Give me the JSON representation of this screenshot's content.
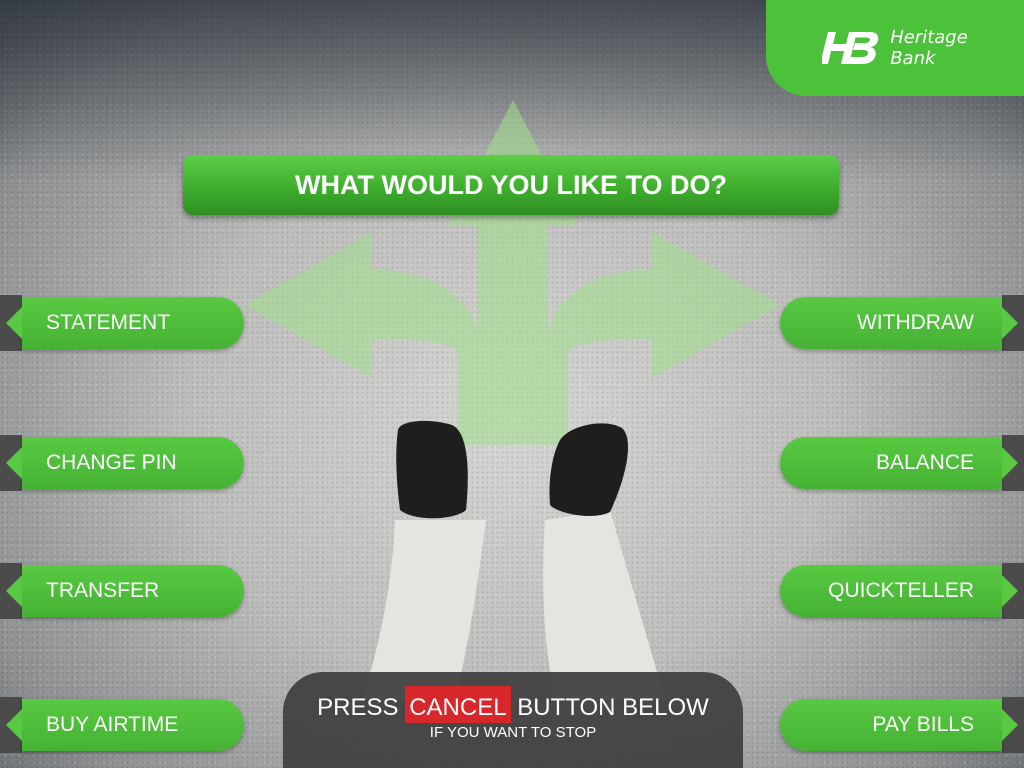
{
  "brand": {
    "logo_line1": "Heritage",
    "logo_line2": "Bank",
    "color": "#4cc13a"
  },
  "prompt": {
    "title": "WHAT WOULD YOU LIKE TO DO?"
  },
  "options": {
    "left": [
      {
        "label": "STATEMENT"
      },
      {
        "label": "CHANGE PIN"
      },
      {
        "label": "TRANSFER"
      },
      {
        "label": "BUY AIRTIME"
      }
    ],
    "right": [
      {
        "label": "WITHDRAW"
      },
      {
        "label": "BALANCE"
      },
      {
        "label": "QUICKTELLER"
      },
      {
        "label": "PAY BILLS"
      }
    ]
  },
  "cancel": {
    "before": "PRESS ",
    "highlight": "CANCEL",
    "after": " BUTTON BELOW",
    "sub": "IF YOU WANT TO STOP",
    "highlight_color": "#d8272b"
  },
  "icons": {
    "logo": "heritage-bank-logo-icon",
    "background": "crossroads-arrows-icon",
    "person": "feet-icon",
    "option_pointer": "arrow-pointer-icon"
  }
}
